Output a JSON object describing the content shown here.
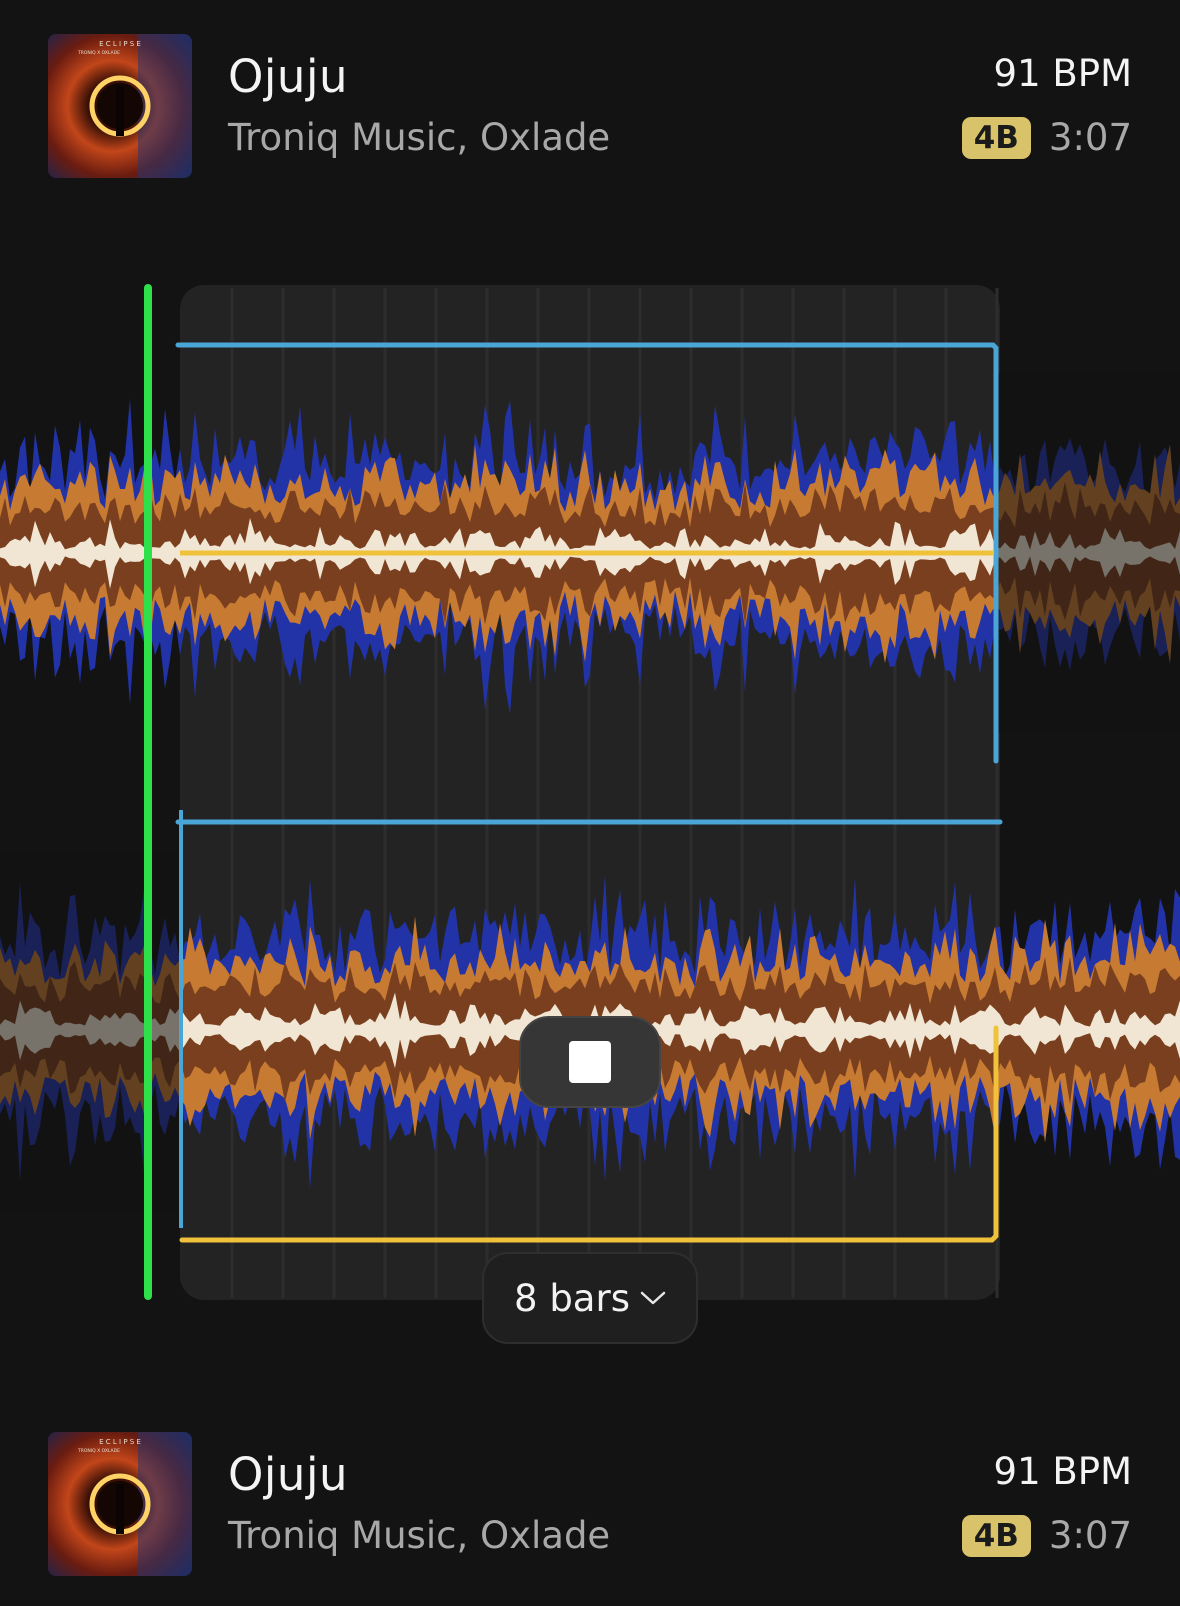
{
  "tracks": [
    {
      "title": "Ojuju",
      "artist": "Troniq Music, Oxlade",
      "bpm": "91 BPM",
      "key": "4B",
      "duration": "3:07",
      "cover_text": "E C L I P S E",
      "cover_sub": "TRONIQ X OXLADE"
    },
    {
      "title": "Ojuju",
      "artist": "Troniq Music, Oxlade",
      "bpm": "91 BPM",
      "key": "4B",
      "duration": "3:07",
      "cover_text": "E C L I P S E",
      "cover_sub": "TRONIQ X OXLADE"
    }
  ],
  "loop": {
    "length_label": "8 bars",
    "chevron_icon": "chevron-down-icon",
    "stop_icon": "stop-icon"
  },
  "colors": {
    "background": "#131313",
    "playhead": "#2ee04a",
    "loop_outline": "#4aa6d6",
    "beat_line": "#f0c23a",
    "key_badge": "#d8c36a",
    "wave_blue": "#2233a8",
    "wave_orange": "#c67a32",
    "wave_brown": "#7a3f1e",
    "wave_cream": "#f1e6d4"
  }
}
